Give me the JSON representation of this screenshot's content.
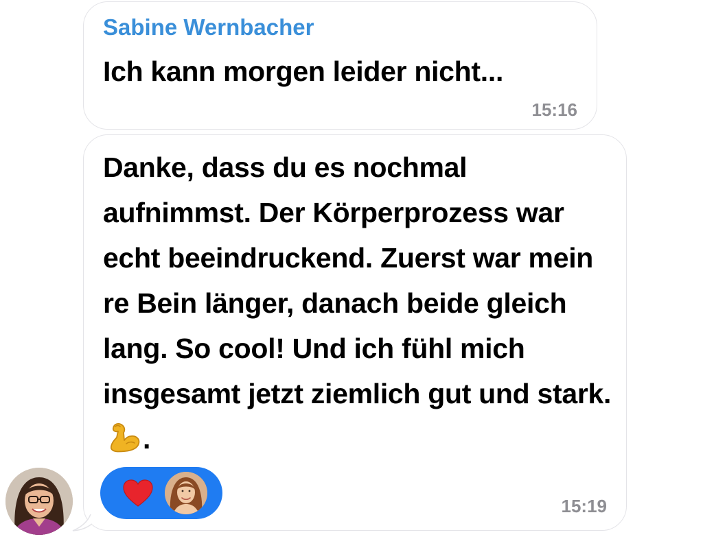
{
  "messages": [
    {
      "sender": "Sabine Wernbacher",
      "text": "Ich kann morgen leider nicht...",
      "time": "15:16"
    },
    {
      "text": "Danke, dass du es nochmal aufnimmst. Der Körperprozess war echt beeindruckend. Zuerst war mein re Bein länger, danach beide gleich lang. So cool! Und ich fühl mich insgesamt jetzt ziemlich gut und stark.",
      "text_suffix": ".",
      "emoji": "flexed-biceps-icon",
      "time": "15:19",
      "reaction": {
        "icon": "heart-icon",
        "reactor": "avatar"
      }
    }
  ],
  "colors": {
    "sender_name": "#3a8fd9",
    "timestamp": "#8e8e93",
    "reaction_pill": "#1f7cf2",
    "heart": "#e8242c",
    "bubble_border": "#e4e4e8"
  }
}
